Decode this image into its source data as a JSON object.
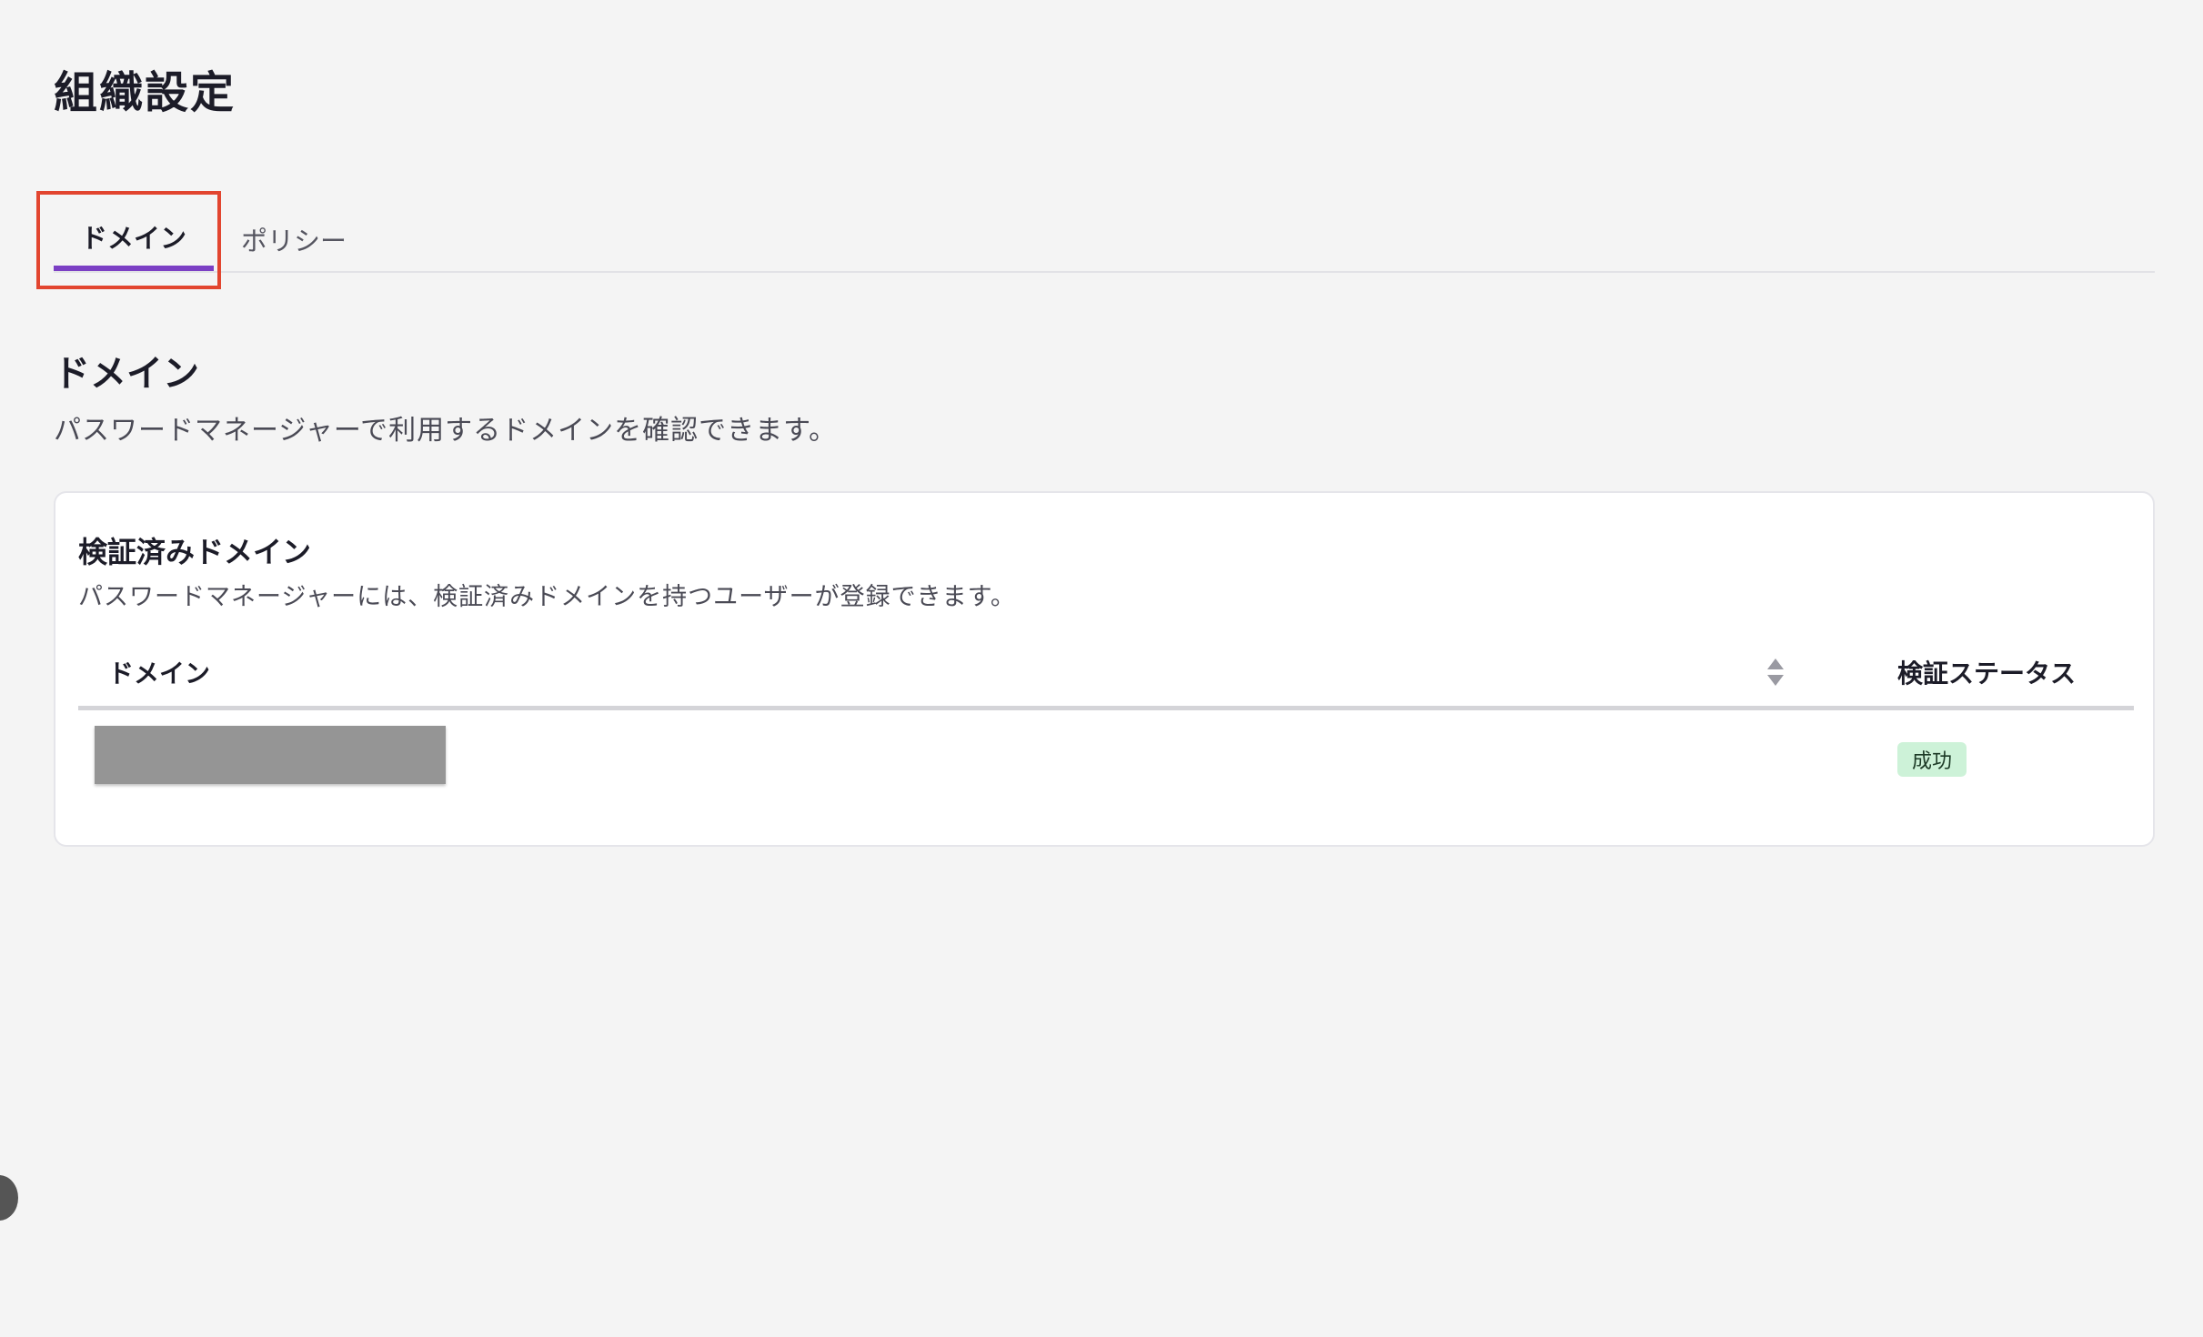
{
  "page": {
    "title": "組織設定"
  },
  "tabs": [
    {
      "label": "ドメイン",
      "active": true
    },
    {
      "label": "ポリシー",
      "active": false
    }
  ],
  "section": {
    "title": "ドメイン",
    "description": "パスワードマネージャーで利用するドメインを確認できます。"
  },
  "card": {
    "title": "検証済みドメイン",
    "description": "パスワードマネージャーには、検証済みドメインを持つユーザーが登録できます。",
    "columns": {
      "domain": "ドメイン",
      "status": "検証ステータス"
    },
    "rows": [
      {
        "domain": "",
        "status": "成功"
      }
    ]
  },
  "colors": {
    "accent": "#7b3fc4",
    "highlight": "#e2452f",
    "success_bg": "#cdf2d8",
    "background": "#f4f4f4"
  },
  "icons": {
    "sort": "sort-icon",
    "floating": "circle-button"
  }
}
